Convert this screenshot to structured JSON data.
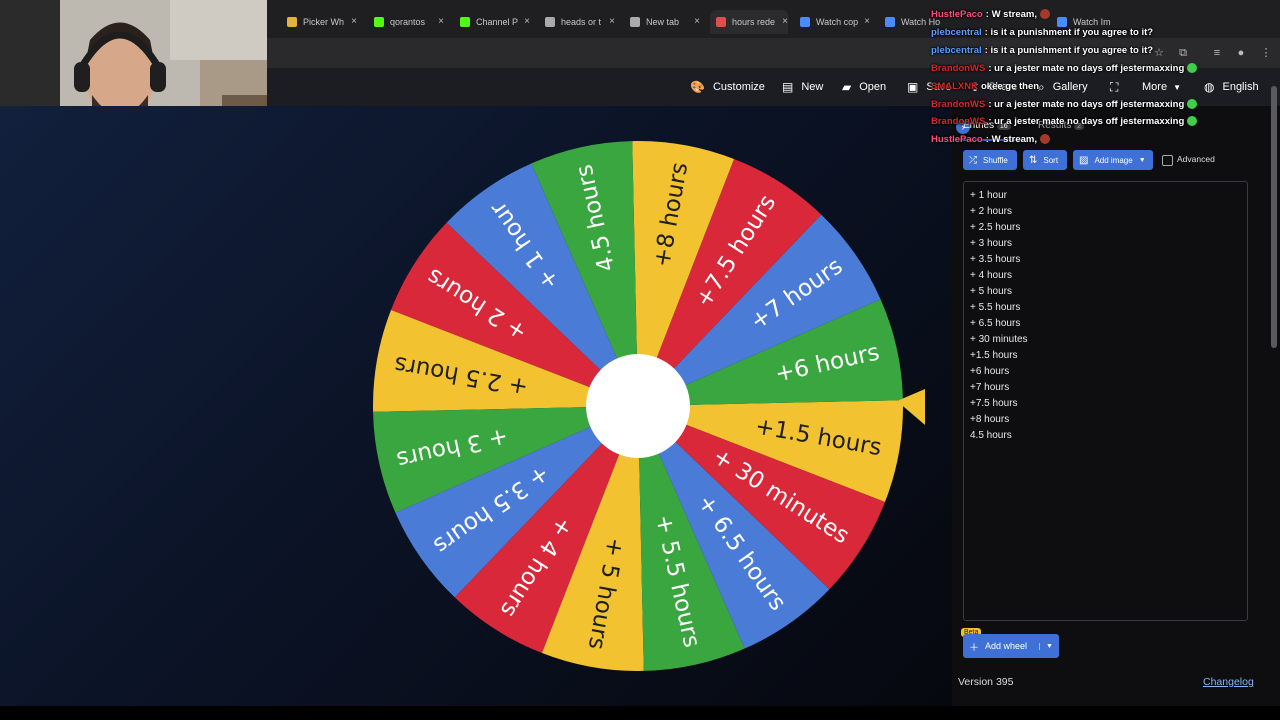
{
  "browser": {
    "tabs": [
      {
        "label": "Picker Wh",
        "color": "#e3b23c"
      },
      {
        "label": "qorantos",
        "color": "#53fc18"
      },
      {
        "label": "Channel P",
        "color": "#53fc18"
      },
      {
        "label": "heads or t",
        "color": "#aaaaaa"
      },
      {
        "label": "New tab",
        "color": "#aaaaaa"
      },
      {
        "label": "hours rede",
        "color": "#e34c4c"
      },
      {
        "label": "Watch cop",
        "color": "#4a8cff"
      },
      {
        "label": "Watch Ho",
        "color": "#4a8cff"
      },
      {
        "label": "Watch Im",
        "color": "#4a8cff"
      }
    ],
    "close_glyph": "×"
  },
  "appbar": {
    "customize": "Customize",
    "new": "New",
    "open": "Open",
    "save": "Save",
    "share": "Share",
    "gallery": "Gallery",
    "more": "More",
    "language": "English"
  },
  "wheel": {
    "segments": [
      {
        "label": "+1.5 hours",
        "color": "#f2c231"
      },
      {
        "label": "+6 hours",
        "color": "#3aa63f"
      },
      {
        "label": "+7 hours",
        "color": "#4a7bd6"
      },
      {
        "label": "+7.5 hours",
        "color": "#d8283a"
      },
      {
        "label": "+8 hours",
        "color": "#f2c231"
      },
      {
        "label": "4.5 hours",
        "color": "#3aa63f"
      },
      {
        "label": "+ 1 hour",
        "color": "#4a7bd6"
      },
      {
        "label": "+ 2 hours",
        "color": "#d8283a"
      },
      {
        "label": "+ 2.5 hours",
        "color": "#f2c231"
      },
      {
        "label": "+ 3 hours",
        "color": "#3aa63f"
      },
      {
        "label": "+ 3.5 hours",
        "color": "#4a7bd6"
      },
      {
        "label": "+ 4 hours",
        "color": "#d8283a"
      },
      {
        "label": "+ 5 hours",
        "color": "#f2c231"
      },
      {
        "label": "+ 5.5 hours",
        "color": "#3aa63f"
      },
      {
        "label": "+ 6.5 hours",
        "color": "#4a7bd6"
      },
      {
        "label": "+ 30 minutes",
        "color": "#d8283a"
      }
    ],
    "pointer_color": "#f2c231"
  },
  "sidebar": {
    "tabs": {
      "entries": "Entries",
      "entries_count": "16",
      "results": "Results",
      "results_count": "2"
    },
    "buttons": {
      "shuffle": "Shuffle",
      "sort": "Sort",
      "add_image": "Add image",
      "advanced": "Advanced"
    },
    "entries": [
      "+ 1 hour",
      "+ 2 hours",
      "+ 2.5 hours",
      "+ 3 hours",
      "+ 3.5 hours",
      "+ 4 hours",
      "+ 5 hours",
      "+ 5.5 hours",
      "+ 6.5 hours",
      "+ 30 minutes",
      "+1.5 hours",
      "+6 hours",
      "+7 hours",
      "+7.5 hours",
      "+8 hours",
      "4.5 hours"
    ],
    "beta": "Beta",
    "add_wheel": "Add wheel",
    "version": "Version 395",
    "changelog": "Changelog"
  },
  "chat": [
    {
      "user": "HustlePaco",
      "user_color": "#ff4b7d",
      "text": "W stream,",
      "emote": "red"
    },
    {
      "user": "plebcentral",
      "user_color": "#5aa0ff",
      "text": "is it a punishment if you agree to it?",
      "emote": ""
    },
    {
      "user": "plebcentral",
      "user_color": "#5aa0ff",
      "text": "is it a punishment if you agree to it?",
      "emote": ""
    },
    {
      "user": "BrandonWS",
      "user_color": "#d22a2a",
      "text": "ur a jester mate no days off jestermaxxing",
      "emote": "green"
    },
    {
      "user": "SMALXNK",
      "user_color": "#d22a2a",
      "text": "okee ge then",
      "emote": ""
    },
    {
      "user": "BrandonWS",
      "user_color": "#d22a2a",
      "text": "ur a jester mate no days off jestermaxxing",
      "emote": "green"
    },
    {
      "user": "BrandonWS",
      "user_color": "#d22a2a",
      "text": "ur a jester mate no days off jestermaxxing",
      "emote": "green"
    },
    {
      "user": "HustlePaco",
      "user_color": "#ff4b7d",
      "text": "W stream,",
      "emote": "red"
    }
  ]
}
